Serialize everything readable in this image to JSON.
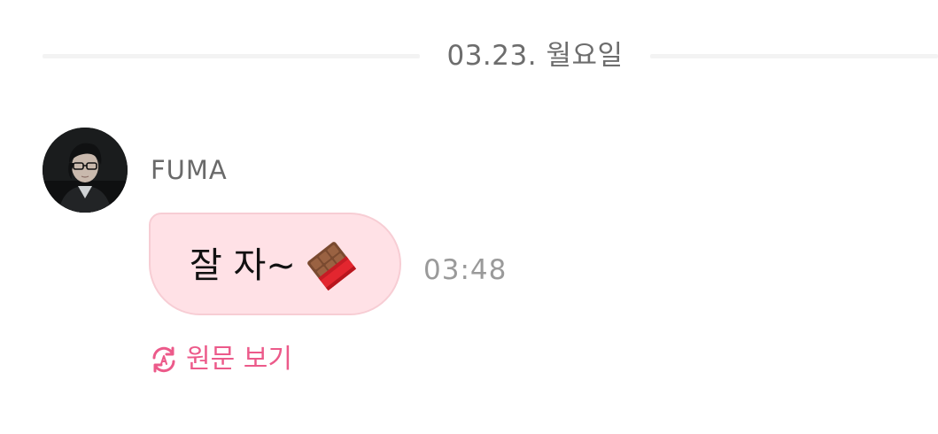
{
  "date_divider": {
    "label": "03.23. 월요일"
  },
  "message": {
    "sender": "FUMA",
    "text": "잘 자~",
    "emoji_icon": "chocolate-bar-icon",
    "time": "03:48"
  },
  "view_original": {
    "label": "원문 보기",
    "icon": "translate-refresh-icon"
  },
  "colors": {
    "bubble_bg": "#ffe1e6",
    "bubble_border": "#f7cdd4",
    "accent": "#ec5a8a",
    "muted_text": "#9a9a9a"
  }
}
